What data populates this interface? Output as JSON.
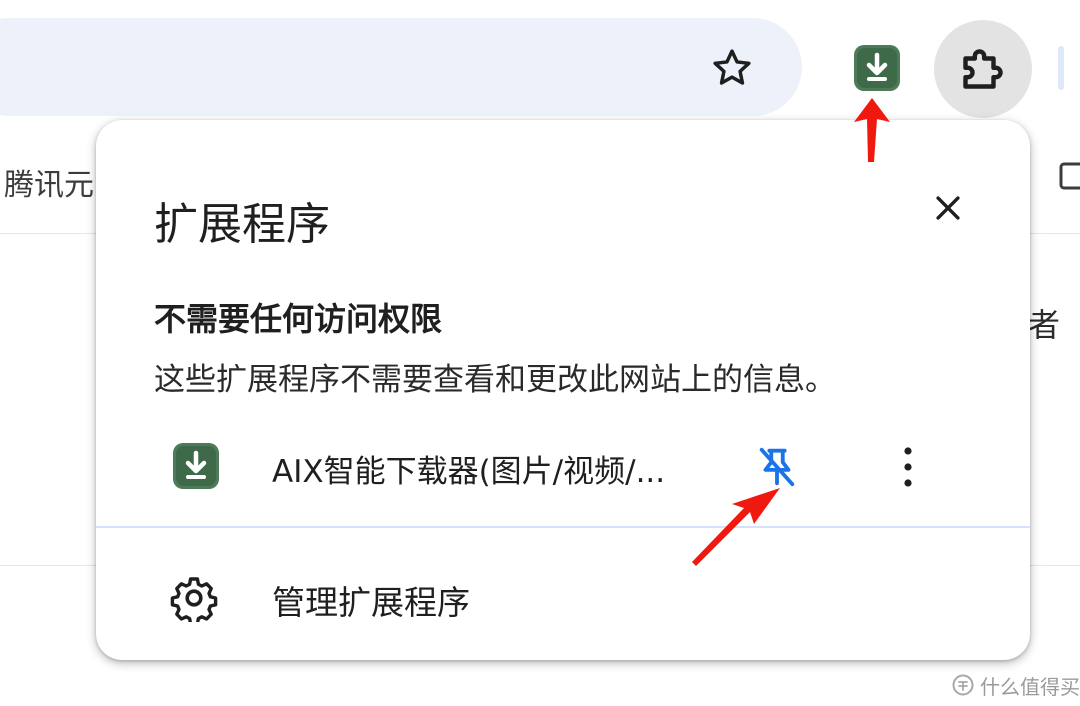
{
  "toolbar": {
    "bookmark_icon": "star-outline-icon",
    "pinned_extension_icon": "download-icon",
    "extensions_menu_icon": "puzzle-piece-icon"
  },
  "bookmarks_bar": {
    "item_label": "腾讯元"
  },
  "page": {
    "partial_text_right": "者"
  },
  "popup": {
    "title": "扩展程序",
    "close_icon": "close-icon",
    "section": {
      "heading": "不需要任何访问权限",
      "description": "这些扩展程序不需要查看和更改此网站上的信息。"
    },
    "extensions": [
      {
        "name": "AIX智能下载器(图片/视频/...",
        "icon": "download-icon",
        "pin_icon": "unpin-icon",
        "more_icon": "more-vertical-icon"
      }
    ],
    "manage": {
      "label": "管理扩展程序",
      "icon": "gear-icon"
    }
  },
  "watermark": {
    "text": "什么值得买"
  },
  "colors": {
    "extension_icon_bg": "#4f7a58",
    "pin_accent": "#1a73e8",
    "annotation_arrow": "#f0190f",
    "omnibox_bg": "#edf2fa"
  }
}
